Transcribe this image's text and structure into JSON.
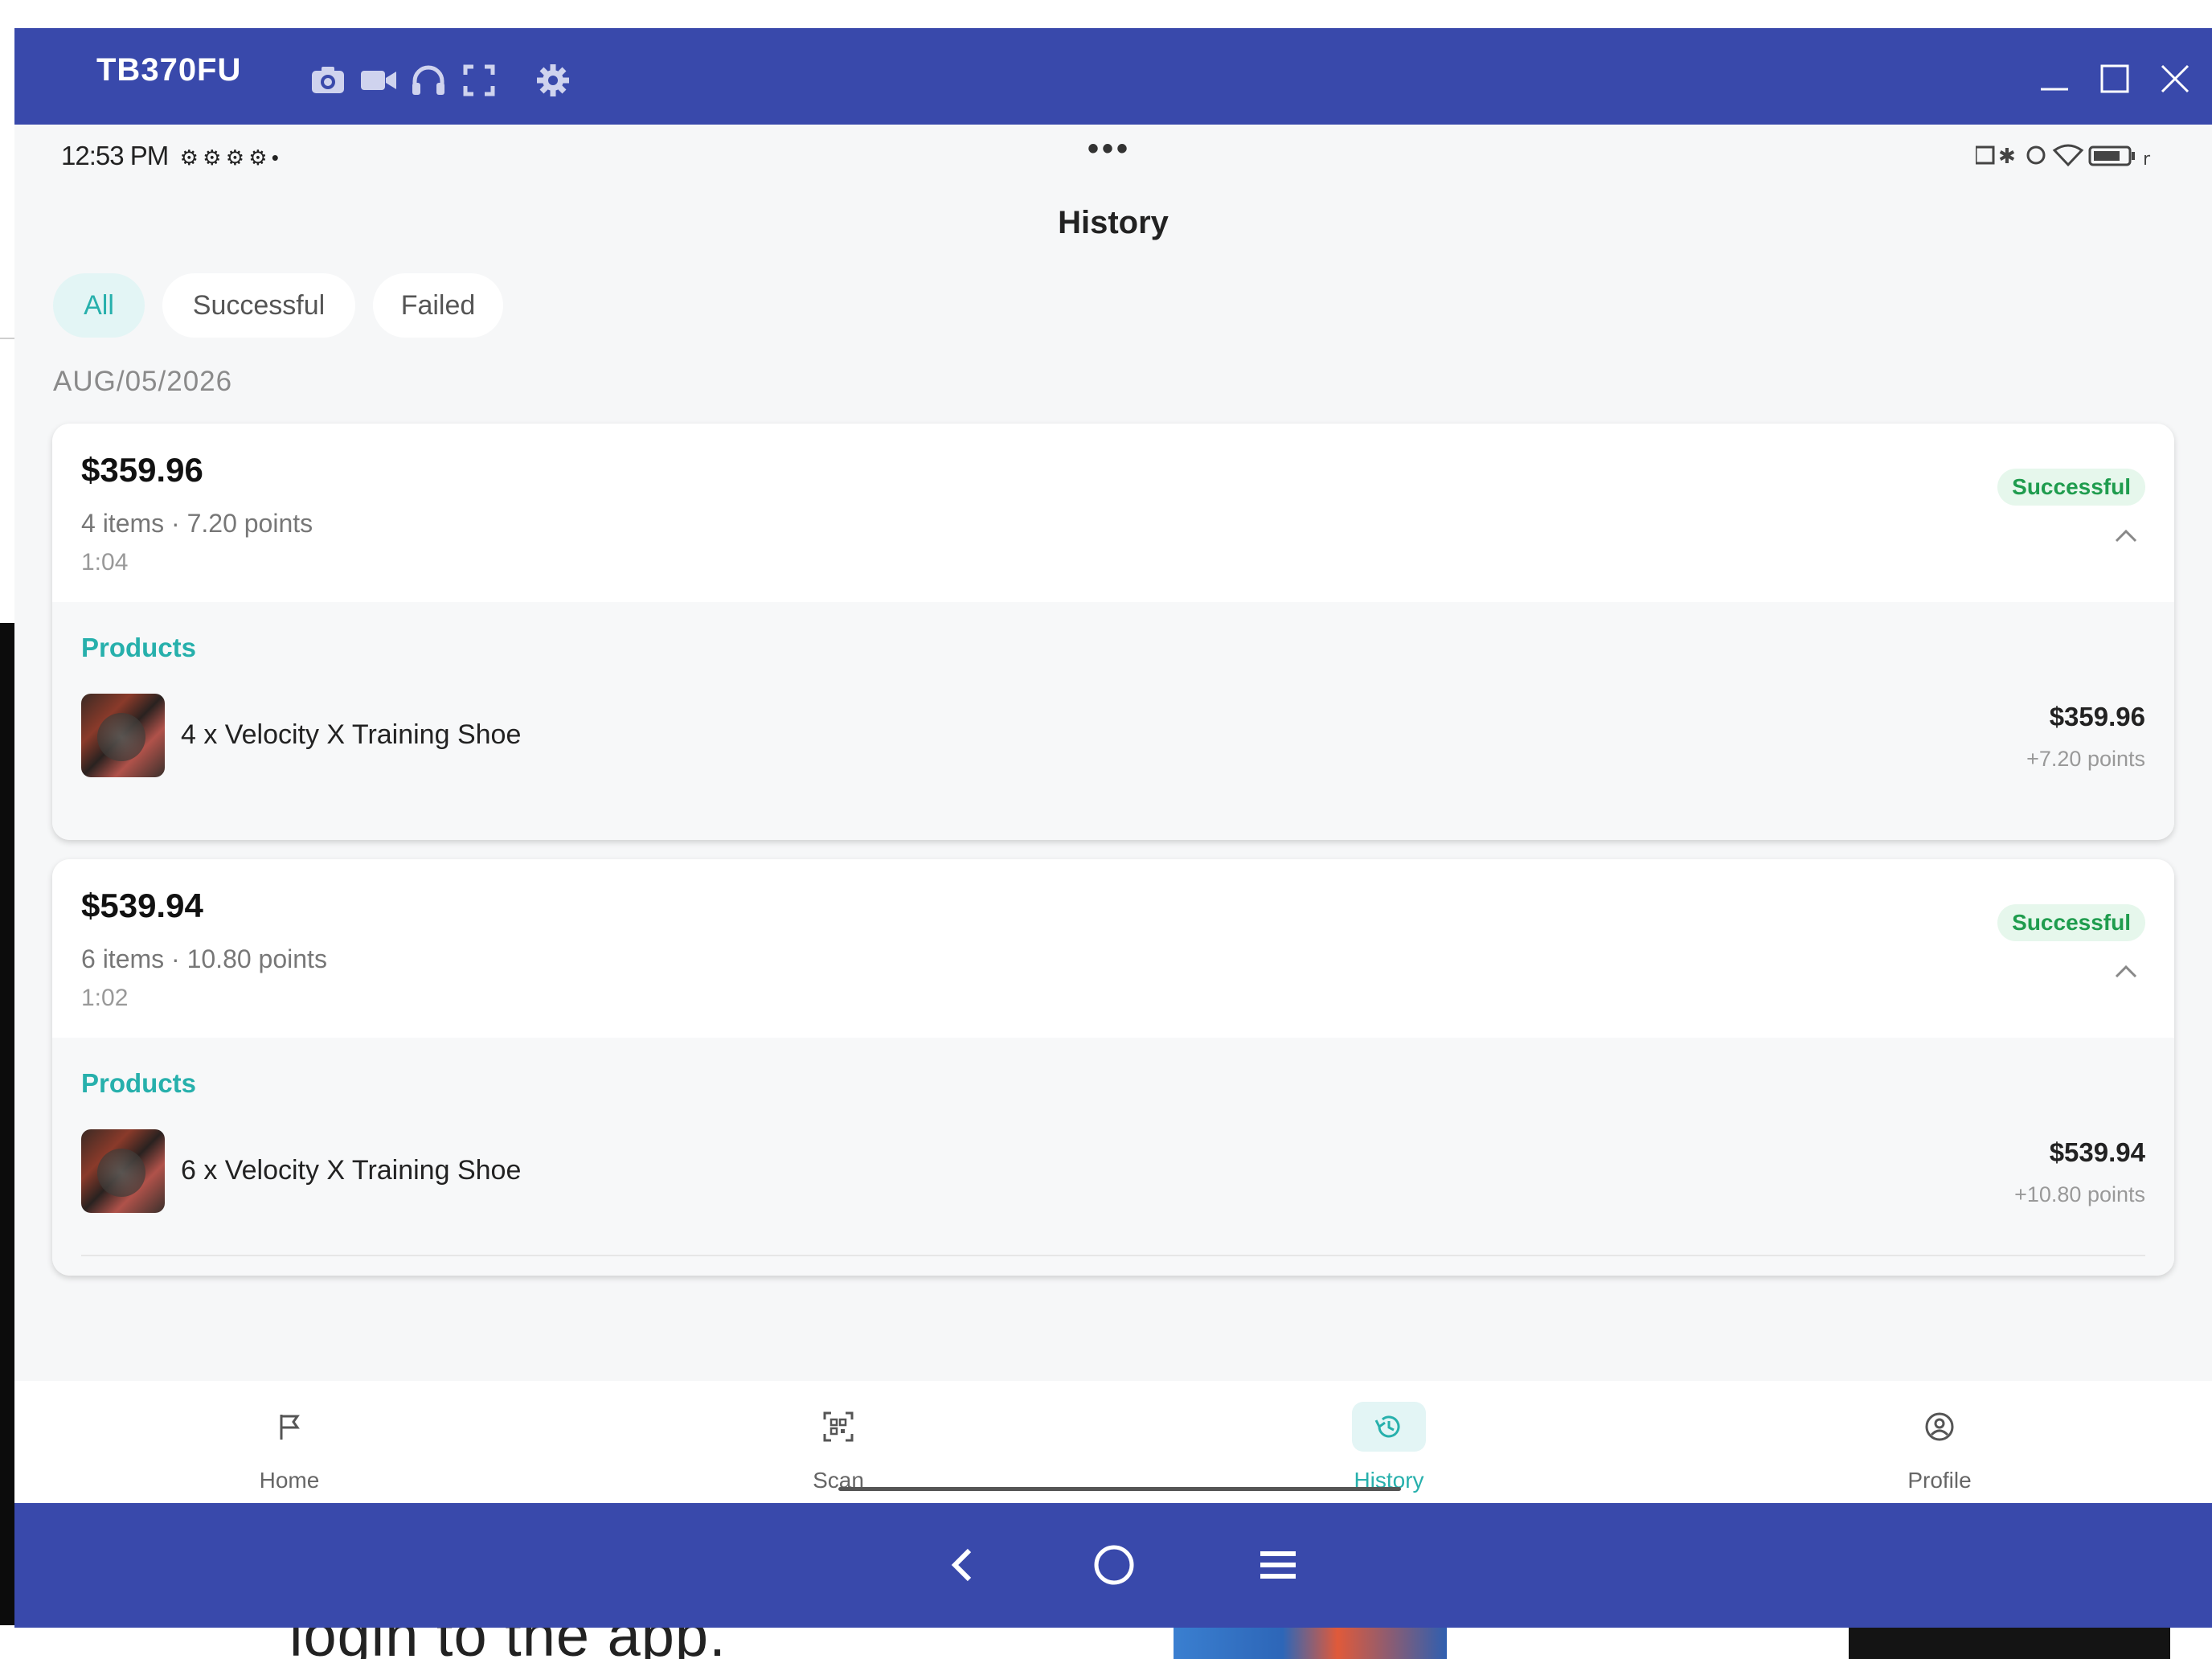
{
  "desktop": {
    "bottom_text": "login to the app."
  },
  "window": {
    "device_name": "TB370FU",
    "toolbar_icons": [
      "camera-icon",
      "video-icon",
      "headphones-icon",
      "fullscreen-icon",
      "gear-icon"
    ],
    "controls": [
      "minimize-icon",
      "maximize-icon",
      "close-icon"
    ],
    "titlebar_color": "#3949ab"
  },
  "status_bar": {
    "time": "12:53 PM",
    "dots": "•••"
  },
  "page": {
    "title": "History",
    "filters": [
      "All",
      "Successful",
      "Failed"
    ],
    "active_filter": "All",
    "accent_color": "#27b0ac",
    "groups": [
      {
        "date": "AUG/05/2026",
        "transactions": [
          {
            "amount": "$359.96",
            "summary": "4 items · 7.20 points",
            "time": "1:04",
            "status": "Successful",
            "products_label": "Products",
            "products": [
              {
                "name": "4 x Velocity X Training Shoe",
                "price": "$359.96",
                "points": "+7.20 points"
              }
            ]
          },
          {
            "amount": "$539.94",
            "summary": "6 items · 10.80 points",
            "time": "1:02",
            "status": "Successful",
            "products_label": "Products",
            "products": [
              {
                "name": "6 x Velocity X Training Shoe",
                "price": "$539.94",
                "points": "+10.80 points"
              }
            ]
          }
        ]
      }
    ]
  },
  "bottom_nav": {
    "items": [
      {
        "label": "Home",
        "icon": "flag-icon"
      },
      {
        "label": "Scan",
        "icon": "qr-scan-icon"
      },
      {
        "label": "History",
        "icon": "history-icon"
      },
      {
        "label": "Profile",
        "icon": "profile-icon"
      }
    ],
    "active": "History"
  },
  "system_nav": [
    "back-icon",
    "home-circle-icon",
    "recents-menu-icon"
  ]
}
